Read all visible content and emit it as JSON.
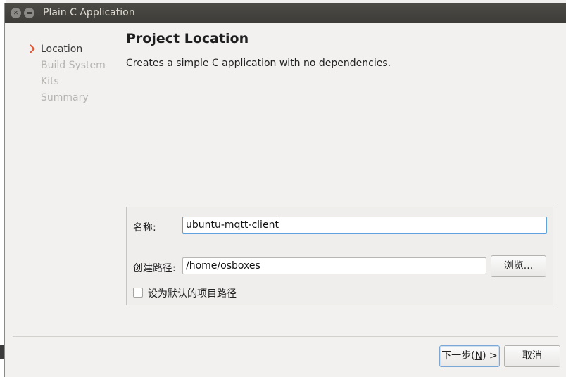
{
  "window": {
    "title": "Plain C Application"
  },
  "steps": [
    {
      "label": "Location",
      "active": true
    },
    {
      "label": "Build System",
      "active": false
    },
    {
      "label": "Kits",
      "active": false
    },
    {
      "label": "Summary",
      "active": false
    }
  ],
  "page": {
    "title": "Project Location",
    "subtitle": "Creates a simple C application with no dependencies."
  },
  "form": {
    "name_label": "名称:",
    "name_value": "ubuntu-mqtt-client",
    "path_label": "创建路径:",
    "path_value": "/home/osboxes",
    "browse_label": "浏览...",
    "default_checkbox_label": "设为默认的项目路径",
    "default_checked": false
  },
  "footer": {
    "next_label_prefix": "下一步(",
    "next_mnemonic": "N",
    "next_label_suffix": ") >",
    "cancel_label": "取消"
  },
  "colors": {
    "accent": "#e0532d",
    "titlebar": "#3d3c38",
    "focus": "#5fa2dd"
  }
}
